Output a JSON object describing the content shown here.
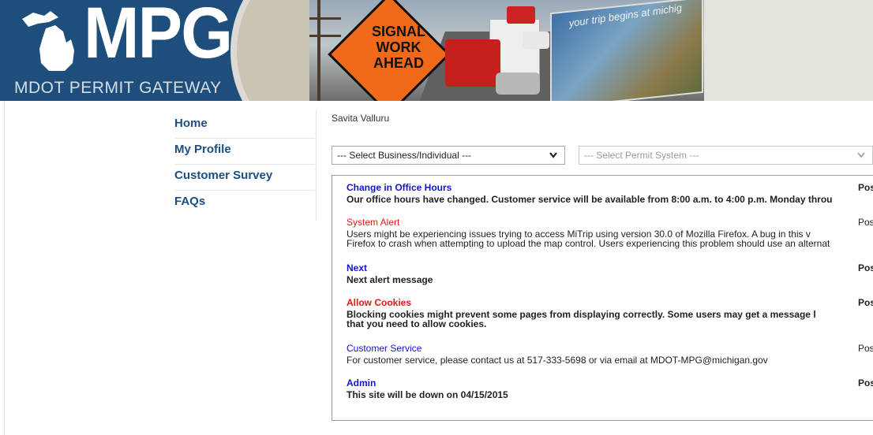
{
  "header": {
    "logo_text": "MPG",
    "logo_subtitle": "MDOT PERMIT GATEWAY",
    "sign_text": "SIGNAL WORK AHEAD",
    "billboard_text": "your trip begins at michig"
  },
  "nav": {
    "items": [
      {
        "label": "Home"
      },
      {
        "label": "My Profile"
      },
      {
        "label": "Customer Survey"
      },
      {
        "label": "FAQs"
      }
    ]
  },
  "user": {
    "name": "Savita Valluru"
  },
  "selects": {
    "business": "--- Select Business/Individual ---",
    "permit": "--- Select Permit System ---"
  },
  "alerts": [
    {
      "title": "Change in Office Hours",
      "posted": "Posted",
      "body": [
        "Our office hours have changed. Customer service will be available from 8:00 a.m. to 4:00 p.m. Monday throu"
      ]
    },
    {
      "title": "System Alert",
      "posted": "Posted",
      "body": [
        "Users might be experiencing issues trying to access MiTrip using version 30.0 of Mozilla Firefox. A bug in this v",
        "Firefox to crash when attempting to upload the map control. Users experiencing this problem should use an alternat"
      ]
    },
    {
      "title": "Next",
      "posted": "Posted",
      "body": [
        "Next alert message"
      ]
    },
    {
      "title": "Allow Cookies",
      "posted": "Posted",
      "body": [
        "Blocking cookies might prevent some pages from displaying correctly. Some users may get a message l",
        "that you need to allow cookies."
      ]
    },
    {
      "title": "Customer Service",
      "posted": "Posted",
      "body": [
        "For customer service, please contact us at 517-333-5698 or via email at MDOT-MPG@michigan.gov"
      ]
    },
    {
      "title": "Admin",
      "posted": "Posted",
      "body": [
        "This site will be down on 04/15/2015"
      ]
    }
  ]
}
